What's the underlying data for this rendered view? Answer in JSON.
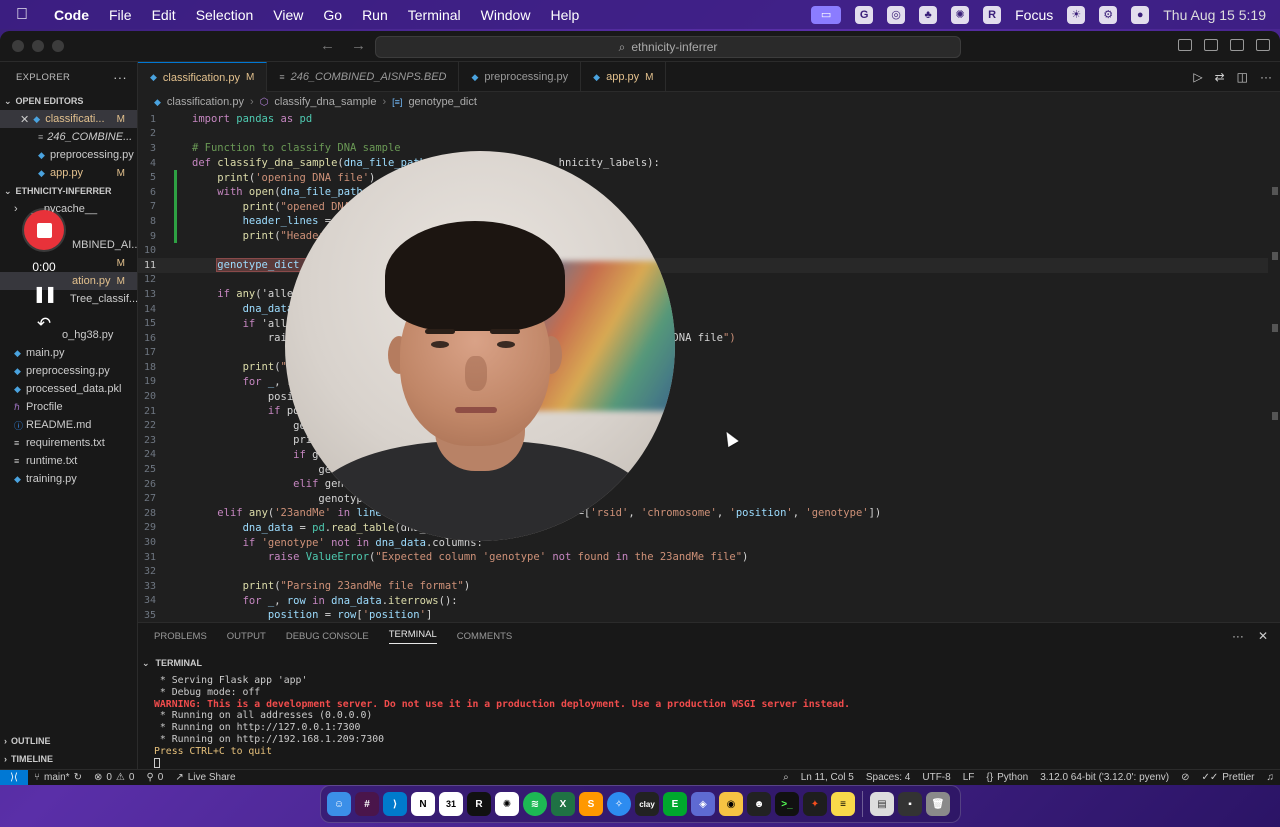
{
  "menubar": {
    "app_name": "Code",
    "items": [
      "File",
      "Edit",
      "Selection",
      "View",
      "Go",
      "Run",
      "Terminal",
      "Window",
      "Help"
    ],
    "focus_label": "Focus",
    "datetime": "Thu Aug 15  5:19"
  },
  "titlebar": {
    "search_text": "ethnicity-inferrer"
  },
  "sidebar": {
    "title": "EXPLORER",
    "open_editors_label": "OPEN EDITORS",
    "open_editors": [
      {
        "name": "classificati...",
        "badge": "M"
      },
      {
        "name": "246_COMBINE...",
        "badge": ""
      },
      {
        "name": "preprocessing.py",
        "badge": ""
      },
      {
        "name": "app.py",
        "badge": "M"
      }
    ],
    "project_label": "ETHNICITY-INFERRER",
    "files": [
      {
        "name": "__pycache__",
        "badge": ""
      },
      {
        "name": "",
        "badge": ""
      },
      {
        "name": "MBINED_AI...",
        "badge": ""
      },
      {
        "name": "",
        "badge": "M"
      },
      {
        "name": "ation.py",
        "badge": "M"
      },
      {
        "name": "Tree_classif...",
        "badge": ""
      },
      {
        "name": "",
        "badge": ""
      },
      {
        "name": "o_hg38.py",
        "badge": ""
      },
      {
        "name": "main.py",
        "badge": ""
      },
      {
        "name": "preprocessing.py",
        "badge": ""
      },
      {
        "name": "processed_data.pkl",
        "badge": ""
      },
      {
        "name": "Procfile",
        "badge": ""
      },
      {
        "name": "README.md",
        "badge": ""
      },
      {
        "name": "requirements.txt",
        "badge": ""
      },
      {
        "name": "runtime.txt",
        "badge": ""
      },
      {
        "name": "training.py",
        "badge": ""
      }
    ],
    "outline_label": "OUTLINE",
    "timeline_label": "TIMELINE"
  },
  "tabs": [
    {
      "label": "classification.py",
      "badge": "M"
    },
    {
      "label": "246_COMBINED_AISNPS.BED",
      "badge": ""
    },
    {
      "label": "preprocessing.py",
      "badge": ""
    },
    {
      "label": "app.py",
      "badge": "M"
    }
  ],
  "breadcrumb": {
    "file": "classification.py",
    "function": "classify_dna_sample",
    "symbol": "genotype_dict"
  },
  "editor": {
    "line_numbers": [
      "1",
      "2",
      "3",
      "4",
      "5",
      "6",
      "7",
      "8",
      "9",
      "10",
      "11",
      "12",
      "13",
      "14",
      "15",
      "16",
      "17",
      "18",
      "19",
      "20",
      "21",
      "22",
      "23",
      "24",
      "25",
      "26",
      "27",
      "28",
      "29",
      "30",
      "31",
      "32",
      "33",
      "34",
      "35"
    ],
    "lines": [
      "import pandas as pd",
      "",
      "# Function to classify DNA sample",
      "def classify_dna_sample(dna_file_path,                    hnicity_labels):",
      "    print('opening DNA file')",
      "    with open(dna_file_path,",
      "        print(\"opened DNA",
      "        header_lines = [",
      "        print(\"Header",
      "",
      "    genotype_dict = ",
      "",
      "    if any('allel",
      "        dna_data",
      "        if 'alle",
      "            rais                                              n the AncestryDNA file\")",
      "",
      "        print(\"P",
      "        for _, r",
      "            posit",
      "            if pos",
      "                ge",
      "                prin                                              \")",
      "                if ge",
      "                    gen",
      "                elif geno",
      "                    genotype_",
      "    elif any('23andMe' in line                ment='#', names=['rsid', 'chromosome', 'position', 'genotype'])",
      "        dna_data = pd.read_table(dna_",
      "        if 'genotype' not in dna_data.columns:",
      "            raise ValueError(\"Expected column 'genotype' not found in the 23andMe file\")",
      "",
      "        print(\"Parsing 23andMe file format\")",
      "        for _, row in dna_data.iterrows():",
      "            position = row['position']"
    ],
    "current_line": "11"
  },
  "panel": {
    "tabs": [
      "PROBLEMS",
      "OUTPUT",
      "DEBUG CONSOLE",
      "TERMINAL",
      "COMMENTS"
    ],
    "active_tab": "TERMINAL",
    "terminal_header": "TERMINAL",
    "terminal_lines": [
      " * Serving Flask app 'app'",
      " * Debug mode: off",
      "WARNING: This is a development server. Do not use it in a production deployment. Use a production WSGI server instead.",
      " * Running on all addresses (0.0.0.0)",
      " * Running on http://127.0.0.1:7300",
      " * Running on http://192.168.1.209:7300",
      "Press CTRL+C to quit"
    ]
  },
  "statusbar": {
    "branch": "main*",
    "errors": "0",
    "warnings": "0",
    "ports": "0",
    "live_share": "Live Share",
    "position": "Ln 11, Col 5",
    "spaces": "Spaces: 4",
    "encoding": "UTF-8",
    "eol": "LF",
    "language": "Python",
    "interpreter": "3.12.0 64-bit ('3.12.0': pyenv)",
    "formatter": "Prettier"
  },
  "recorder": {
    "time": "0:00"
  },
  "dock": {
    "icons": [
      "finder-icon",
      "slack-icon",
      "vscode-icon",
      "notion-icon",
      "calendar-icon",
      "r-icon",
      "chatgpt-icon",
      "spotify-icon",
      "excel-icon",
      "sublime-icon",
      "safari-icon",
      "clay-icon",
      "evernote-icon",
      "linear-icon",
      "camera-icon",
      "alien-icon",
      "terminal-icon",
      "figma-icon",
      "notes-icon",
      "preview-icon",
      "window-icon",
      "trash-icon"
    ],
    "clay_label": "clay"
  }
}
